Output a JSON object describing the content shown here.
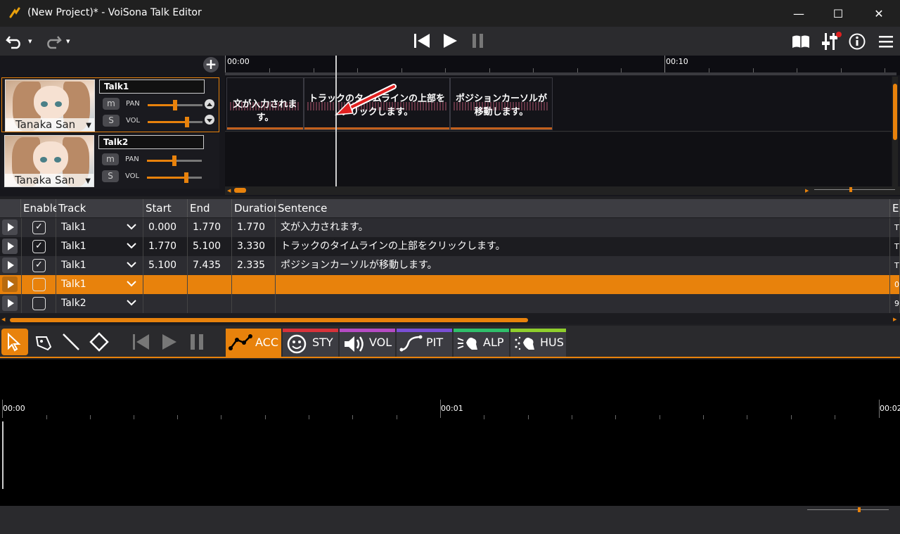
{
  "window": {
    "title": "(New Project)* - VoiSona Talk Editor",
    "minimize": "—",
    "maximize": "☐",
    "close": "✕"
  },
  "toolbar": {
    "undo": "undo-icon",
    "redo": "redo-icon",
    "dropdown": "▾"
  },
  "transport": {
    "prev": "skip-back-icon",
    "play": "play-icon",
    "pause": "pause-icon"
  },
  "tracks": [
    {
      "name": "Talk1",
      "voice": "Tanaka San",
      "mute": "m",
      "solo": "S",
      "pan_label": "PAN",
      "vol_label": "VOL",
      "pan": 0.5,
      "vol": 0.72
    },
    {
      "name": "Talk2",
      "voice": "Tanaka San",
      "mute": "m",
      "solo": "S",
      "pan_label": "PAN",
      "vol_label": "VOL",
      "pan": 0.5,
      "vol": 0.72
    }
  ],
  "timeline": {
    "add_track": "+",
    "ruler": [
      "00:00",
      "00:10"
    ],
    "clips": [
      {
        "text": "文が入力されます。"
      },
      {
        "text": "トラックのタイムラインの上部を\nクリックします。"
      },
      {
        "text": "ポジションカーソルが\n移動します。"
      }
    ]
  },
  "table": {
    "columns": [
      "Enable",
      "Track",
      "Start",
      "End",
      "Duration",
      "Sentence",
      "E"
    ],
    "rows": [
      {
        "enabled": true,
        "track": "Talk1",
        "start": "0.000",
        "end": "1.770",
        "duration": "1.770",
        "sentence": "文が入力されます。",
        "extra": "T",
        "selected": false
      },
      {
        "enabled": true,
        "track": "Talk1",
        "start": "1.770",
        "end": "5.100",
        "duration": "3.330",
        "sentence": "トラックのタイムラインの上部をクリックします。",
        "extra": "T",
        "selected": false
      },
      {
        "enabled": true,
        "track": "Talk1",
        "start": "5.100",
        "end": "7.435",
        "duration": "2.335",
        "sentence": "ポジションカーソルが移動します。",
        "extra": "T",
        "selected": false
      },
      {
        "enabled": false,
        "track": "Talk1",
        "start": "",
        "end": "",
        "duration": "",
        "sentence": "",
        "extra": "0",
        "selected": true
      },
      {
        "enabled": false,
        "track": "Talk2",
        "start": "",
        "end": "",
        "duration": "",
        "sentence": "",
        "extra": "9",
        "selected": false
      }
    ]
  },
  "editor": {
    "tabs": [
      {
        "label": "ACC",
        "color": "#e8820c",
        "active": true
      },
      {
        "label": "STY",
        "color": "#d8323a"
      },
      {
        "label": "VOL",
        "color": "#b54bc4"
      },
      {
        "label": "PIT",
        "color": "#7a4fd6"
      },
      {
        "label": "ALP",
        "color": "#2fbf6a"
      },
      {
        "label": "HUS",
        "color": "#8fcf2c"
      }
    ],
    "ruler": [
      "00:00",
      "00:01",
      "00:02"
    ]
  },
  "colors": {
    "accent": "#e8820c",
    "annotation_arrow": "#e02020"
  }
}
